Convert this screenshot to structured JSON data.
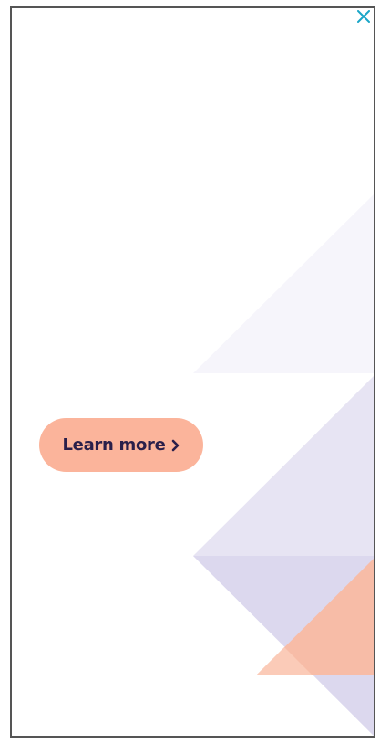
{
  "ad": {
    "cta_label": "Learn more",
    "close_icon": "close-icon",
    "chevron_icon": "chevron-right-icon"
  },
  "colors": {
    "frame_border": "#555555",
    "close_icon": "#1aa6c8",
    "cta_background": "#fbb49b",
    "cta_text": "#2a1f4a",
    "shape_faint_lavender": "#f6f5fb",
    "shape_lavender": "#e7e4f3",
    "shape_lavender_dark": "#dcd8ee",
    "shape_peach": "#f7bca7",
    "shape_peach_light": "#fbcbb8"
  }
}
